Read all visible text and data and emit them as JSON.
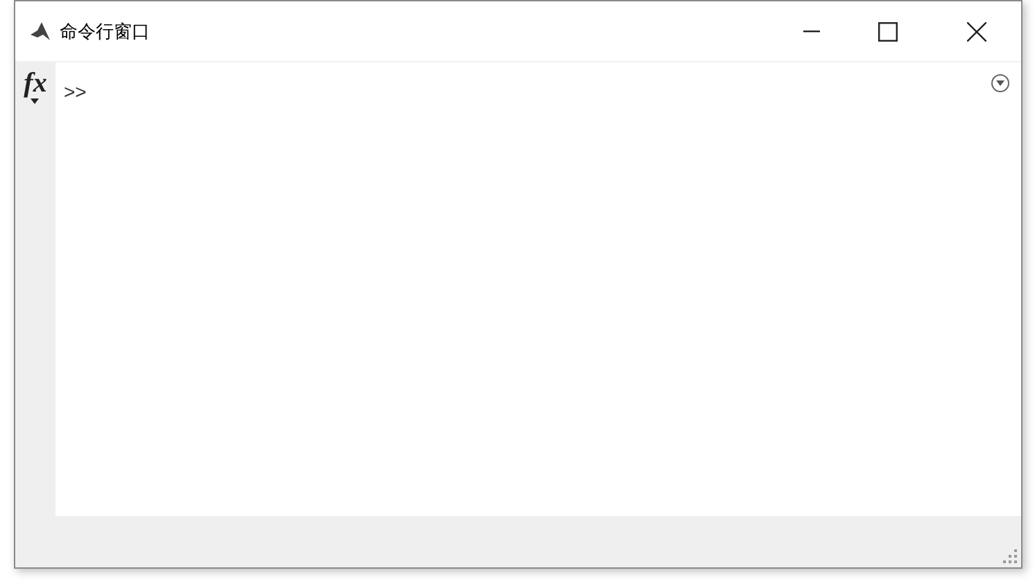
{
  "window": {
    "title": "命令行窗口"
  },
  "gutter": {
    "function_button": "fx"
  },
  "console": {
    "prompt": ">>"
  }
}
